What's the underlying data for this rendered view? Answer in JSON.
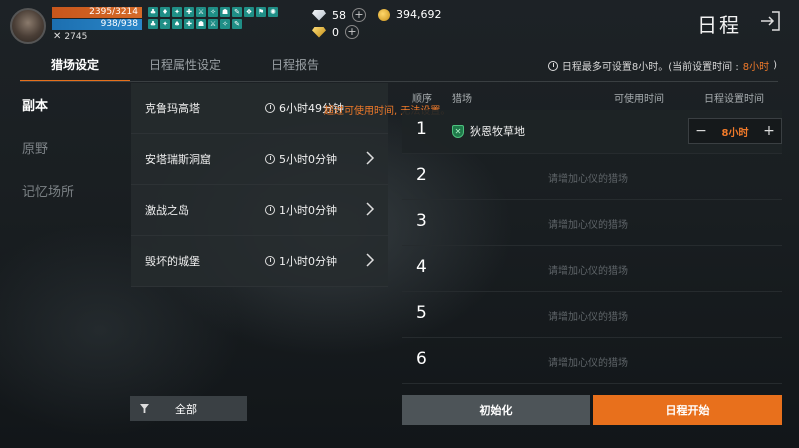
{
  "player": {
    "hp": "2395/3214",
    "mp": "938/938",
    "power": "2745",
    "hp_fraction": 0.745
  },
  "currency": {
    "diamond": "58",
    "gold": "394,692",
    "gold_gem": "0"
  },
  "header": {
    "title": "日程"
  },
  "tabs": [
    {
      "label": "猎场设定",
      "active": true
    },
    {
      "label": "日程属性设定",
      "active": false
    },
    {
      "label": "日程报告",
      "active": false
    }
  ],
  "notice": {
    "text": "日程最多可设置8小时。(当前设置时间 : ",
    "highlight": "8小时",
    "suffix": ")"
  },
  "sidebar": {
    "items": [
      {
        "label": "副本",
        "active": true
      },
      {
        "label": "原野",
        "active": false
      },
      {
        "label": "记忆场所",
        "active": false
      }
    ]
  },
  "dungeons": [
    {
      "name": "克鲁玛高塔",
      "time": "6小时49分钟"
    },
    {
      "name": "安塔瑞斯洞窟",
      "time": "5小时0分钟"
    },
    {
      "name": "激战之岛",
      "time": "1小时0分钟"
    },
    {
      "name": "毁坏的城堡",
      "time": "1小时0分钟"
    }
  ],
  "warning": "超过可使用时间, 无法设置。",
  "filter": {
    "label": "全部"
  },
  "schedule": {
    "headers": {
      "order": "顺序",
      "field": "猎场",
      "available": "可使用时间",
      "setting": "日程设置时间"
    },
    "rows": [
      {
        "num": "1",
        "field": "狄恩牧草地",
        "time": "8小时"
      },
      {
        "num": "2",
        "placeholder": "请增加心仪的猎场"
      },
      {
        "num": "3",
        "placeholder": "请增加心仪的猎场"
      },
      {
        "num": "4",
        "placeholder": "请增加心仪的猎场"
      },
      {
        "num": "5",
        "placeholder": "请增加心仪的猎场"
      },
      {
        "num": "6",
        "placeholder": "请增加心仪的猎场"
      }
    ]
  },
  "buttons": {
    "reset": "初始化",
    "start": "日程开始"
  },
  "colors": {
    "accent": "#e8701c",
    "hp": "#c8561c",
    "mp": "#1c6fb0"
  }
}
